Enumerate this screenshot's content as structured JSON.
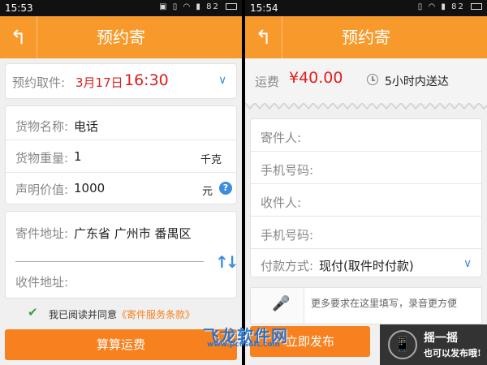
{
  "left": {
    "status": {
      "time": "15:53",
      "battery": "82"
    },
    "title": "预约寄",
    "pickup": {
      "label": "预约取件:",
      "date": "3月17日",
      "time": "16:30"
    },
    "goods": {
      "name_label": "货物名称:",
      "name_value": "电话",
      "weight_label": "货物重量:",
      "weight_value": "1",
      "weight_unit": "千克",
      "value_label": "声明价值:",
      "value_value": "1000",
      "value_unit": "元"
    },
    "address": {
      "send_label": "寄件地址:",
      "send_value": "广东省 广州市 番禺区",
      "recv_label": "收件地址:"
    },
    "agree": {
      "text": "我已阅读并同意",
      "link": "《寄件服务条款》"
    },
    "calc_button": "算算运费"
  },
  "right": {
    "status": {
      "time": "15:54",
      "battery": "82"
    },
    "title": "预约寄",
    "fee": {
      "label": "运费",
      "amount": "¥40.00",
      "eta": "5小时内送达"
    },
    "form": {
      "sender_label": "寄件人:",
      "sender_phone_label": "手机号码:",
      "receiver_label": "收件人:",
      "receiver_phone_label": "手机号码:",
      "payment_label": "付款方式:",
      "payment_value": "现付(取件时付款)"
    },
    "notes_placeholder": "更多要求在这里填写，录音更方便",
    "publish_button": "立即发布",
    "shake": {
      "line1": "摇一摇",
      "line2": "也可以发布哦!"
    }
  },
  "watermark": {
    "main": "飞龙软件网",
    "sub": "www.pc6soft.com"
  },
  "colors": {
    "accent": "#f79a2b",
    "button": "#f7811f",
    "price": "#e02020",
    "link_blue": "#3b8de0"
  }
}
